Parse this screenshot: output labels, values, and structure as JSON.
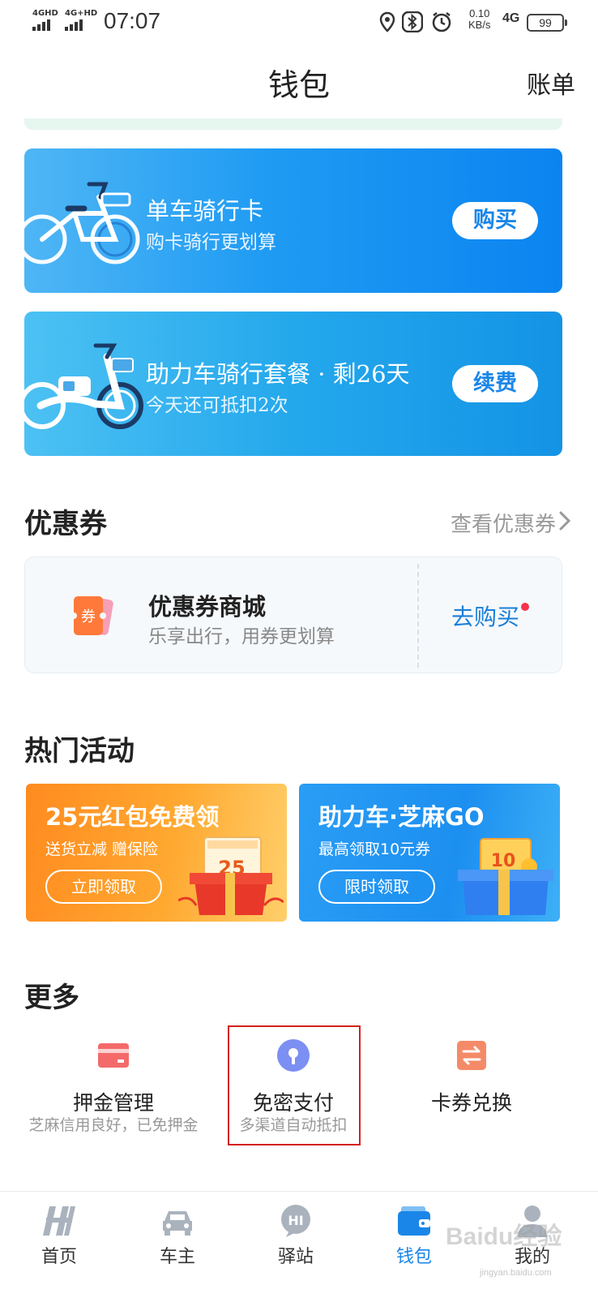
{
  "status_bar": {
    "signal_1": "4GHD",
    "signal_2": "4G+HD",
    "time": "07:07",
    "net_speed_value": "0.10",
    "net_speed_unit": "KB/s",
    "network_type": "4G",
    "battery": "99",
    "icons": [
      "location-icon",
      "bluetooth-icon",
      "alarm-icon"
    ]
  },
  "header": {
    "title": "钱包",
    "action": "账单"
  },
  "promo_cards": [
    {
      "title": "单车骑行卡",
      "subtitle": "购卡骑行更划算",
      "button": "购买",
      "icon": "bicycle-icon"
    },
    {
      "title": "助力车骑行套餐 · 剩26天",
      "subtitle": "今天还可抵扣2次",
      "button": "续费",
      "icon": "ebike-icon"
    }
  ],
  "coupons": {
    "section_title": "优惠券",
    "view_link": "查看优惠券",
    "mall": {
      "icon_text": "券",
      "title": "优惠券商城",
      "subtitle": "乐享出行，用券更划算",
      "buy_label": "去购买"
    }
  },
  "activities": {
    "section_title": "热门活动",
    "items": [
      {
        "title": "25元红包免费领",
        "subtitle": "送货立减 赠保险",
        "button": "立即领取",
        "art_text": "25",
        "accent": "#ff9a26"
      },
      {
        "title": "助力车·芝麻GO",
        "subtitle": "最高领取10元券",
        "button": "限时领取",
        "art_text": "10",
        "accent": "#1c8ff0"
      }
    ]
  },
  "more": {
    "section_title": "更多",
    "items": [
      {
        "label": "押金管理",
        "subtitle": "芝麻信用良好，已免押金",
        "icon": "card-icon"
      },
      {
        "label": "免密支付",
        "subtitle": "多渠道自动抵扣",
        "icon": "lock-icon",
        "highlighted": true
      },
      {
        "label": "卡券兑换",
        "subtitle": "",
        "icon": "exchange-icon"
      }
    ]
  },
  "bottom_nav": {
    "items": [
      {
        "label": "首页",
        "icon": "home-logo-icon"
      },
      {
        "label": "车主",
        "icon": "car-icon"
      },
      {
        "label": "驿站",
        "icon": "station-icon",
        "icon_text": "HI"
      },
      {
        "label": "钱包",
        "icon": "wallet-icon",
        "active": true
      },
      {
        "label": "我的",
        "icon": "profile-icon"
      }
    ],
    "watermark": "Baidu经验",
    "watermark_sub": "jingyan.baidu.com"
  },
  "colors": {
    "brand_blue": "#1a86e8",
    "highlight_red": "#d5201c",
    "notification_red": "#f5334a"
  }
}
